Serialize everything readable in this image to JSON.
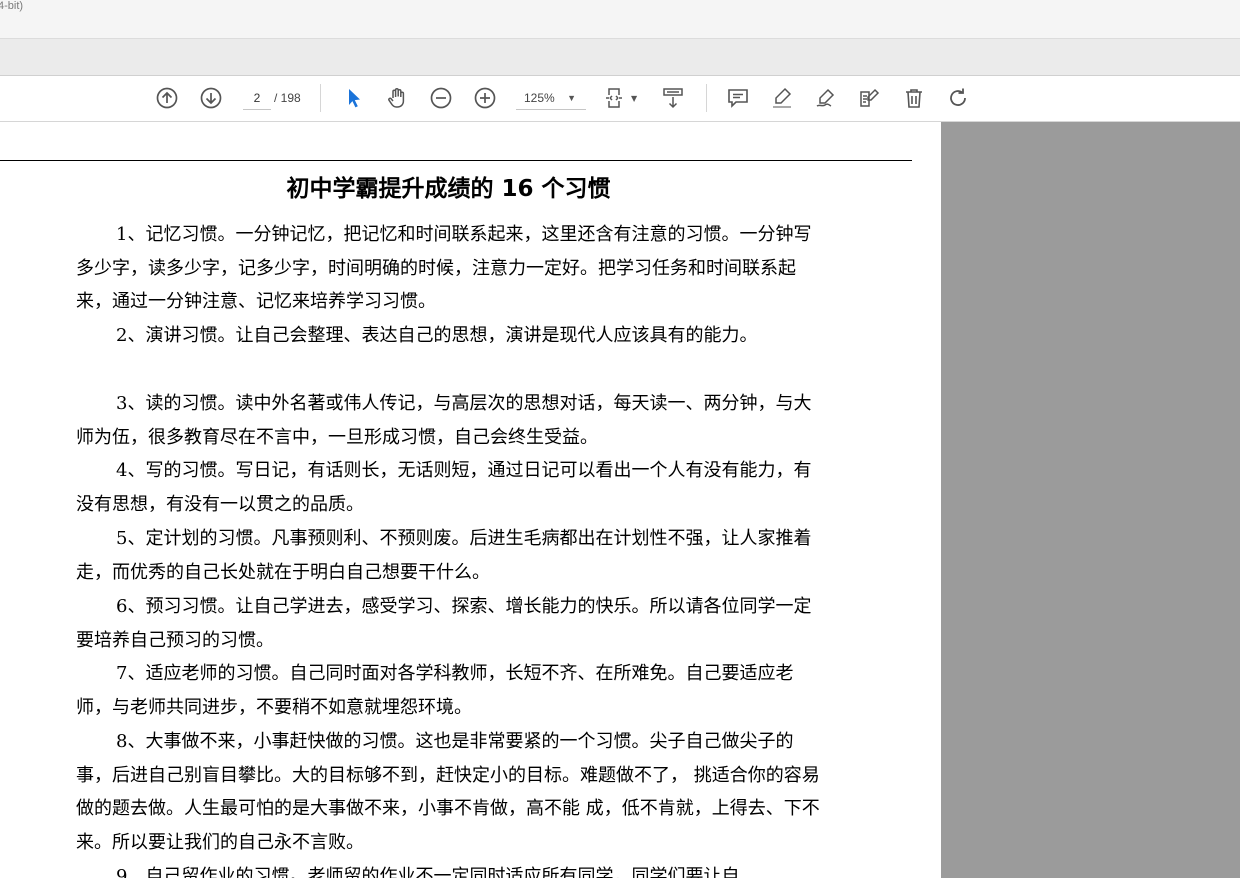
{
  "window": {
    "title_fragment": "4-bit)"
  },
  "toolbar": {
    "current_page": "2",
    "total_pages": "/ 198",
    "zoom": "125%",
    "colors": {
      "select_active": "#1a73d9",
      "icon": "#555555"
    }
  },
  "document": {
    "title": "初中学霸提升成绩的 16 个习惯",
    "paragraphs": [
      "1、记忆习惯。一分钟记忆，把记忆和时间联系起来，这里还含有注意的习惯。一分钟写多少字，读多少字，记多少字，时间明确的时候，注意力一定好。把学习任务和时间联系起来，通过一分钟注意、记忆来培养学习习惯。",
      "2、演讲习惯。让自己会整理、表达自己的思想，演讲是现代人应该具有的能力。",
      "3、读的习惯。读中外名著或伟人传记，与高层次的思想对话，每天读一、两分钟，与大师为伍，很多教育尽在不言中，一旦形成习惯，自己会终生受益。",
      "4、写的习惯。写日记，有话则长，无话则短，通过日记可以看出一个人有没有能力，有没有思想，有没有一以贯之的品质。",
      "5、定计划的习惯。凡事预则利、不预则废。后进生毛病都出在计划性不强，让人家推着走，而优秀的自己长处就在于明白自己想要干什么。",
      "6、预习习惯。让自己学进去，感受学习、探索、增长能力的快乐。所以请各位同学一定要培养自己预习的习惯。",
      "7、适应老师的习惯。自己同时面对各学科教师，长短不齐、在所难免。自己要适应老师，与老师共同进步，不要稍不如意就埋怨环境。",
      "8、大事做不来，小事赶快做的习惯。这也是非常要紧的一个习惯。尖子自己做尖子的事，后进自己别盲目攀比。大的目标够不到，赶快定小的目标。难题做不了， 挑适合你的容易做的题去做。人生最可怕的是大事做不来，小事不肯做，高不能 成，低不肯就，上得去、下不来。所以要让我们的自己永不言败。",
      "9、自己留作业的习惯。老师留的作业不一定同时适应所有同学，同学们要让自"
    ]
  }
}
